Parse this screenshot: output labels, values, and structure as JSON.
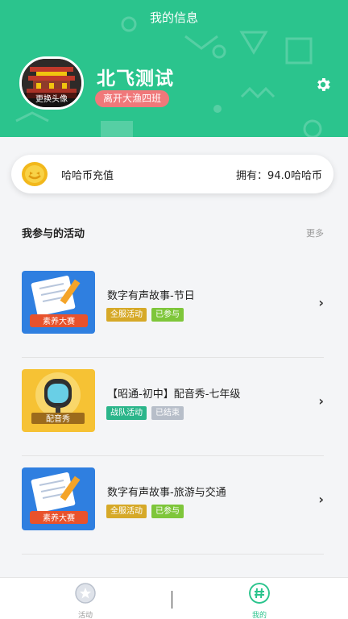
{
  "header": {
    "title": "我的信息"
  },
  "profile": {
    "avatar_label": "更换头像",
    "name": "北飞测试",
    "class": "离开大渔四班"
  },
  "coin": {
    "title": "哈哈币充值",
    "balance": "拥有：94.0哈哈币"
  },
  "activities_section": {
    "title": "我参与的活动",
    "more": "更多"
  },
  "activities": [
    {
      "title": "数字有声故事-节日",
      "tags": [
        "全服活动",
        "已参与"
      ],
      "thumb_label": "素养大赛"
    },
    {
      "title": "【昭通-初中】配音秀-七年级",
      "tags": [
        "战队活动",
        "已结束"
      ],
      "thumb_label": "配音秀"
    },
    {
      "title": "数字有声故事-旅游与交通",
      "tags": [
        "全服活动",
        "已参与"
      ],
      "thumb_label": "素养大赛"
    }
  ],
  "nav": {
    "activities": "活动",
    "mine": "我的"
  },
  "colors": {
    "brand": "#2bc48d",
    "tag_gold": "#d6a928",
    "tag_green": "#7ec63a",
    "tag_teal": "#2bb58a",
    "tag_gray": "#b7bec9",
    "badge_red": "#f0787a"
  }
}
